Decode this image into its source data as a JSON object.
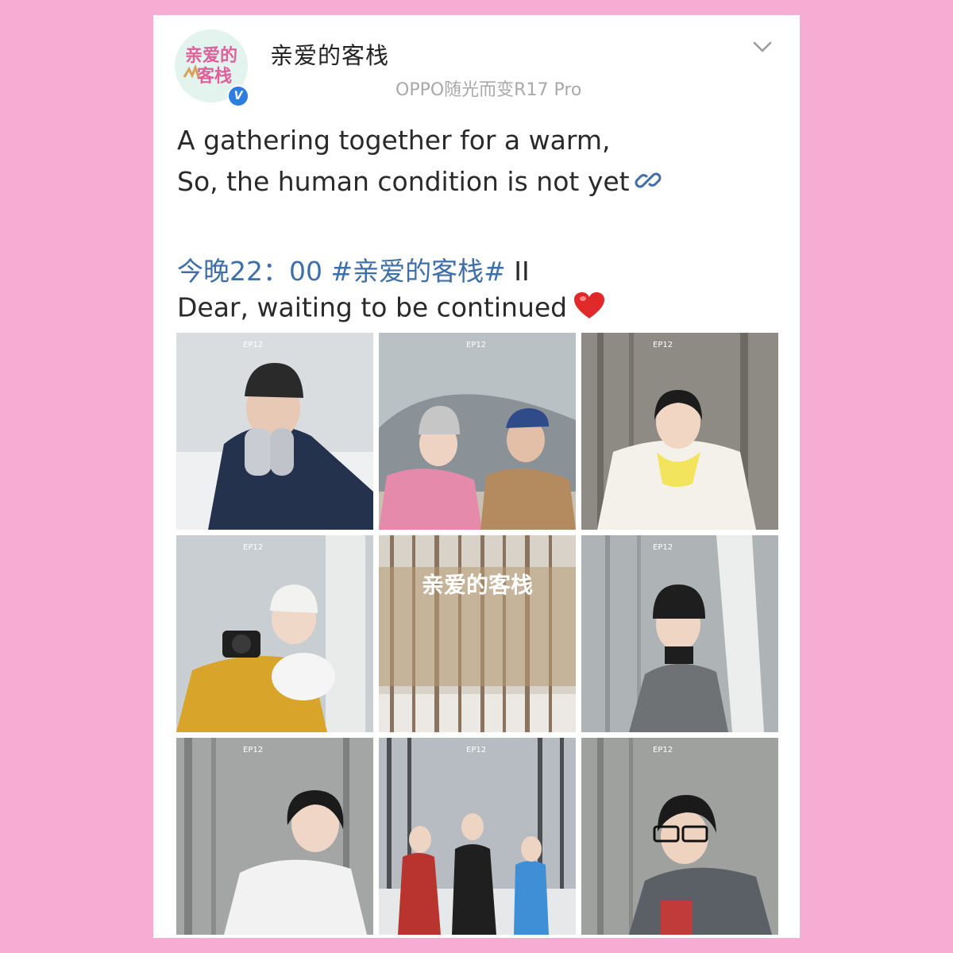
{
  "header": {
    "username": "亲爱的客栈",
    "source": "OPPO随光而变R17 Pro",
    "avatar_logo_text": "亲爱的客栈",
    "verified_badge": "V",
    "menu_icon": "chevron-down-icon"
  },
  "post": {
    "line1": "A gathering together for a warm,",
    "line2": " So, the human condition is not yet",
    "link_icon": "link-icon",
    "line3_blue": "今晚22：00 #亲爱的客栈#",
    "line3_tail": " II",
    "line4": " Dear, waiting to be continued",
    "emoji": "heart-icon"
  },
  "photos": [
    {
      "label": "photo-1",
      "scene": "man in black beanie and navy hoodie in snow",
      "colors": {
        "bg": "#d9dde0",
        "main": "#24324d",
        "accent": "#2a2a2a"
      }
    },
    {
      "label": "photo-2",
      "scene": "couple in pink and tan coats",
      "colors": {
        "bg": "#b9c1c4",
        "main": "#e58aaa",
        "accent": "#b48a5f"
      }
    },
    {
      "label": "photo-3",
      "scene": "girl in white puffer in birch forest",
      "colors": {
        "bg": "#8e8b84",
        "main": "#f3f1ea",
        "accent": "#f2e45c"
      }
    },
    {
      "label": "photo-4",
      "scene": "woman in yellow coat with camera",
      "colors": {
        "bg": "#c9ced2",
        "main": "#d9a42a",
        "accent": "#f5f5f5"
      }
    },
    {
      "label": "photo-5",
      "scene": "bare larch forest with show logo",
      "colors": {
        "bg": "#d8d2c8",
        "main": "#b89a74",
        "accent": "#6e5e4c"
      }
    },
    {
      "label": "photo-6",
      "scene": "young man in grey coat by birch tree",
      "colors": {
        "bg": "#aeb3b5",
        "main": "#6f7275",
        "accent": "#1e1e1e"
      }
    },
    {
      "label": "photo-7",
      "scene": "short haired woman in white jacket",
      "colors": {
        "bg": "#a4a6a6",
        "main": "#f2f2f2",
        "accent": "#1b1b1b"
      }
    },
    {
      "label": "photo-8",
      "scene": "three people on snowy forest road",
      "colors": {
        "bg": "#b6bcc1",
        "main": "#b9332f",
        "accent": "#3f8fd6"
      }
    },
    {
      "label": "photo-9",
      "scene": "person with glasses and black beanie",
      "colors": {
        "bg": "#9fa19f",
        "main": "#5b5f66",
        "accent": "#1a1a1a"
      }
    }
  ],
  "tile_overlay_text": "EP12",
  "center_logo_text": "亲爱的客栈"
}
